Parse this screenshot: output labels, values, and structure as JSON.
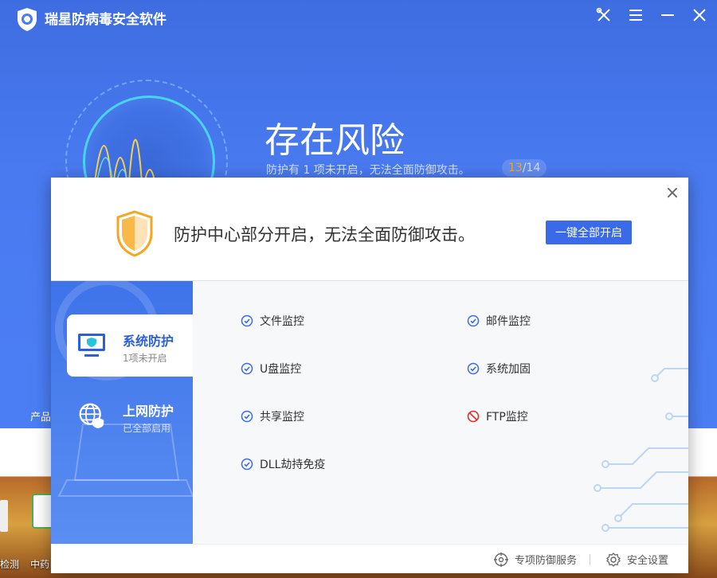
{
  "app": {
    "title": "瑞星防病毒安全软件",
    "status_title": "存在风险",
    "status_subtitle": "防护有 1 项未开启，无法全面防御攻击。",
    "counter_current": "13",
    "counter_sep": "/",
    "counter_total": "14",
    "product_label": "产品"
  },
  "titlebar": {
    "icons": [
      "tools-icon",
      "menu-icon",
      "minimize-icon",
      "close-icon"
    ]
  },
  "modal": {
    "message": "防护中心部分开启，无法全面防御攻击。",
    "enable_all_label": "一键全部开启",
    "nav": [
      {
        "title": "系统防护",
        "subtitle": "1项未开启",
        "active": true
      },
      {
        "title": "上网防护",
        "subtitle": "已全部启用",
        "active": false
      }
    ],
    "items": [
      {
        "label": "文件监控",
        "status": "on"
      },
      {
        "label": "邮件监控",
        "status": "on"
      },
      {
        "label": "U盘监控",
        "status": "on"
      },
      {
        "label": "系统加固",
        "status": "on"
      },
      {
        "label": "共享监控",
        "status": "on"
      },
      {
        "label": "FTP监控",
        "status": "off"
      },
      {
        "label": "DLL劫持免疫",
        "status": "on"
      }
    ],
    "footer": {
      "service_label": "专项防御服务",
      "settings_label": "安全设置"
    }
  },
  "desktop": {
    "icon1_label": "检测",
    "icon2_label": "中药"
  },
  "colors": {
    "accent": "#3a6ae8",
    "ok": "#3a6ae8",
    "off": "#e0312b",
    "warning": "#f5a623"
  }
}
